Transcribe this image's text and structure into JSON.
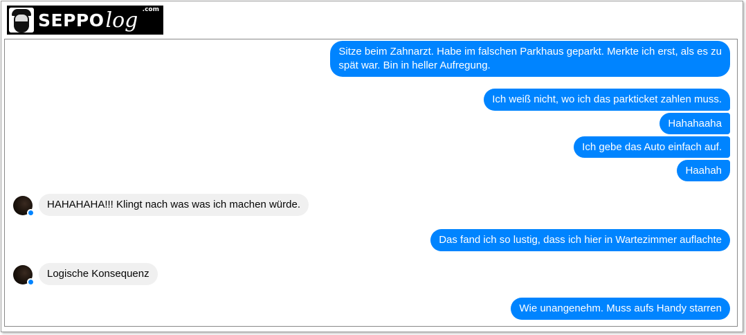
{
  "logo": {
    "text_bold": "SEPPO",
    "text_script": "log",
    "text_suffix": ".com"
  },
  "colors": {
    "outgoing": "#0084ff",
    "incoming": "#f0f0f0"
  },
  "messages": [
    {
      "direction": "outgoing",
      "text_lines": [
        "Sitze beim Zahnarzt. Habe im falschen Parkhaus geparkt. Merkte ich erst, als es zu",
        "spät war. Bin in heller Aufregung."
      ]
    },
    {
      "direction": "outgoing",
      "text": "Ich weiß nicht, wo ich das parkticket zahlen muss."
    },
    {
      "direction": "outgoing",
      "text": "Hahahaaha"
    },
    {
      "direction": "outgoing",
      "text": "Ich gebe das Auto einfach auf."
    },
    {
      "direction": "outgoing",
      "text": "Haahah"
    },
    {
      "direction": "incoming",
      "text": "HAHAHAHA!!! Klingt nach was was ich machen würde."
    },
    {
      "direction": "outgoing",
      "text": "Das fand ich so lustig, dass ich hier in Wartezimmer auflachte"
    },
    {
      "direction": "incoming",
      "text": "Logische Konsequenz"
    },
    {
      "direction": "outgoing",
      "text": "Wie unangenehm. Muss aufs Handy starren"
    }
  ]
}
